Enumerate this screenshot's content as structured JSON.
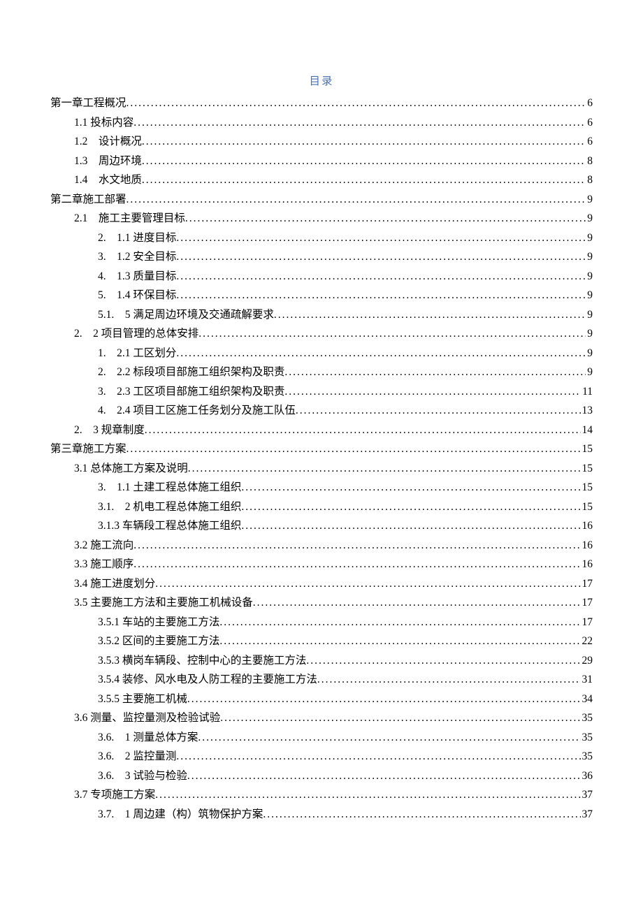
{
  "title": "目录",
  "entries": [
    {
      "indent": 0,
      "label": "第一章工程概况",
      "page": "6"
    },
    {
      "indent": 1,
      "label": "1.1 投标内容",
      "page": "6"
    },
    {
      "indent": 1,
      "label": "1.2　设计概况",
      "page": "6"
    },
    {
      "indent": 1,
      "label": "1.3　周边环境",
      "page": "8"
    },
    {
      "indent": 1,
      "label": "1.4　水文地质",
      "page": "8"
    },
    {
      "indent": 0,
      "label": "第二章施工部署",
      "page": "9"
    },
    {
      "indent": 1,
      "label": "2.1　施工主要管理目标",
      "page": "9"
    },
    {
      "indent": 2,
      "label": "2.　1.1 进度目标",
      "page": "9"
    },
    {
      "indent": 2,
      "label": "3.　1.2 安全目标",
      "page": "9"
    },
    {
      "indent": 2,
      "label": "4.　1.3 质量目标",
      "page": "9"
    },
    {
      "indent": 2,
      "label": "5.　1.4 环保目标",
      "page": "9"
    },
    {
      "indent": 2,
      "label": "5.1.　5 满足周边环境及交通疏解要求",
      "page": "9"
    },
    {
      "indent": 1,
      "label": "2.　2 项目管理的总体安排",
      "page": "9"
    },
    {
      "indent": 2,
      "label": "1.　2.1 工区划分",
      "page": "9"
    },
    {
      "indent": 2,
      "label": "2.　2.2 标段项目部施工组织架构及职责",
      "page": "9"
    },
    {
      "indent": 2,
      "label": "3.　2.3 工区项目部施工组织架构及职责",
      "page": "11"
    },
    {
      "indent": 2,
      "label": "4.　2.4 项目工区施工任务划分及施工队伍",
      "page": "13"
    },
    {
      "indent": 1,
      "label": "2.　3 规章制度",
      "page": "14"
    },
    {
      "indent": 0,
      "label": "第三章施工方案",
      "page": "15"
    },
    {
      "indent": 1,
      "label": "3.1 总体施工方案及说明",
      "page": "15"
    },
    {
      "indent": 2,
      "label": "3.　1.1 土建工程总体施工组织",
      "page": "15"
    },
    {
      "indent": 2,
      "label": "3.1.　2 机电工程总体施工组织",
      "page": "15"
    },
    {
      "indent": 2,
      "label": "3.1.3 车辆段工程总体施工组织",
      "page": "16"
    },
    {
      "indent": 1,
      "label": "3.2 施工流向",
      "page": "16"
    },
    {
      "indent": 1,
      "label": "3.3 施工顺序",
      "page": "16"
    },
    {
      "indent": 1,
      "label": "3.4 施工进度划分",
      "page": "17"
    },
    {
      "indent": 1,
      "label": "3.5 主要施工方法和主要施工机械设备",
      "page": "17"
    },
    {
      "indent": 2,
      "label": "3.5.1 车站的主要施工方法",
      "page": "17"
    },
    {
      "indent": 2,
      "label": "3.5.2 区间的主要施工方法",
      "page": "22"
    },
    {
      "indent": 2,
      "label": "3.5.3 横岗车辆段、控制中心的主要施工方法",
      "page": "29"
    },
    {
      "indent": 2,
      "label": "3.5.4 装修、风水电及人防工程的主要施工方法",
      "page": "31"
    },
    {
      "indent": 2,
      "label": "3.5.5 主要施工机械",
      "page": "34"
    },
    {
      "indent": 1,
      "label": "3.6 测量、监控量测及检验试验",
      "page": "35"
    },
    {
      "indent": 2,
      "label": "3.6.　1 测量总体方案",
      "page": "35"
    },
    {
      "indent": 2,
      "label": "3.6.　2 监控量测",
      "page": "35"
    },
    {
      "indent": 2,
      "label": "3.6.　3 试验与检验",
      "page": "36"
    },
    {
      "indent": 1,
      "label": "3.7 专项施工方案",
      "page": "37"
    },
    {
      "indent": 2,
      "label": "3.7.　1 周边建（构）筑物保护方案",
      "page": "37"
    }
  ]
}
